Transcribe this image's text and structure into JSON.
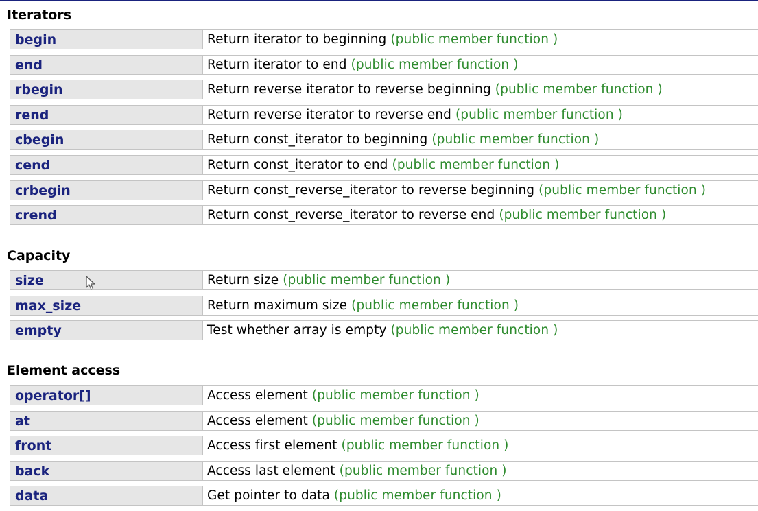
{
  "sections": [
    {
      "title": "Iterators",
      "rows": [
        {
          "name": "begin",
          "desc": "Return iterator to beginning",
          "tag": "(public member function )"
        },
        {
          "name": "end",
          "desc": "Return iterator to end",
          "tag": "(public member function )"
        },
        {
          "name": "rbegin",
          "desc": "Return reverse iterator to reverse beginning",
          "tag": "(public member function )"
        },
        {
          "name": "rend",
          "desc": "Return reverse iterator to reverse end",
          "tag": "(public member function )"
        },
        {
          "name": "cbegin",
          "desc": "Return const_iterator to beginning",
          "tag": "(public member function )"
        },
        {
          "name": "cend",
          "desc": "Return const_iterator to end",
          "tag": "(public member function )"
        },
        {
          "name": "crbegin",
          "desc": "Return const_reverse_iterator to reverse beginning",
          "tag": "(public member function )"
        },
        {
          "name": "crend",
          "desc": "Return const_reverse_iterator to reverse end",
          "tag": "(public member function )"
        }
      ]
    },
    {
      "title": "Capacity",
      "rows": [
        {
          "name": "size",
          "desc": "Return size",
          "tag": "(public member function )"
        },
        {
          "name": "max_size",
          "desc": "Return maximum size",
          "tag": "(public member function )"
        },
        {
          "name": "empty",
          "desc": "Test whether array is empty",
          "tag": "(public member function )"
        }
      ]
    },
    {
      "title": "Element access",
      "rows": [
        {
          "name": "operator[]",
          "desc": "Access element",
          "tag": "(public member function )"
        },
        {
          "name": "at",
          "desc": "Access element",
          "tag": "(public member function )"
        },
        {
          "name": "front",
          "desc": "Access first element",
          "tag": "(public member function )"
        },
        {
          "name": "back",
          "desc": "Access last element",
          "tag": "(public member function )"
        },
        {
          "name": "data",
          "desc": "Get pointer to data",
          "tag": "(public member function )"
        }
      ]
    }
  ],
  "colors": {
    "link": "#1a237e",
    "tag": "#2e8b2e",
    "name_cell_bg": "#e6e6e6",
    "border": "#c4c4c4"
  },
  "icons": {
    "cursor": "mouse-pointer-icon"
  }
}
